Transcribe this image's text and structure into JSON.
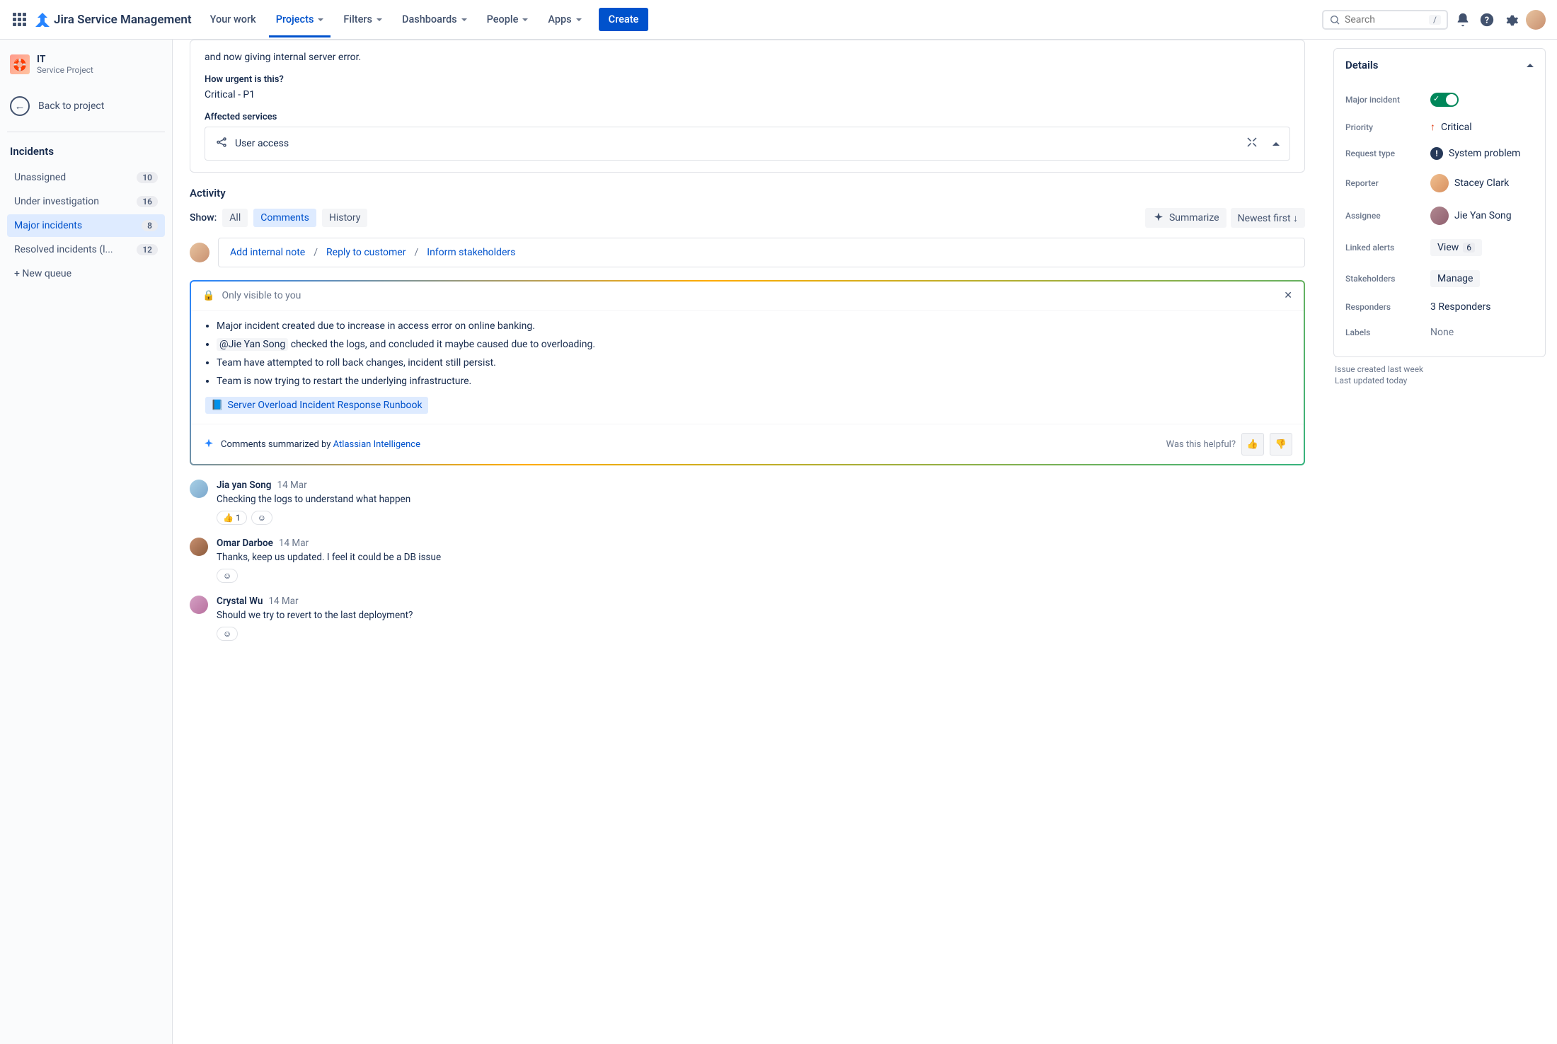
{
  "brand": "Jira Service Management",
  "nav": {
    "your_work": "Your work",
    "projects": "Projects",
    "filters": "Filters",
    "dashboards": "Dashboards",
    "people": "People",
    "apps": "Apps",
    "create": "Create",
    "search_placeholder": "Search",
    "search_kbd": "/"
  },
  "sidebar": {
    "project_name": "IT",
    "project_type": "Service Project",
    "back": "Back to project",
    "heading": "Incidents",
    "queues": [
      {
        "label": "Unassigned",
        "count": "10"
      },
      {
        "label": "Under investigation",
        "count": "16"
      },
      {
        "label": "Major incidents",
        "count": "8"
      },
      {
        "label": "Resolved incidents (l...",
        "count": "12"
      }
    ],
    "new_queue": "+ New queue"
  },
  "ticket": {
    "desc_tail": "and now giving internal server error.",
    "urgent_label": "How urgent is this?",
    "urgent_value": "Critical - P1",
    "affected_label": "Affected services",
    "service": "User access"
  },
  "activity": {
    "heading": "Activity",
    "show": "Show:",
    "all": "All",
    "comments": "Comments",
    "history": "History",
    "summarize": "Summarize",
    "newest": "Newest first ↓",
    "add_note": "Add internal note",
    "reply": "Reply to customer",
    "inform": "Inform stakeholders"
  },
  "ai": {
    "only_visible": "Only visible to you",
    "bullets": {
      "b1": "Major incident created due to increase in access error on online banking.",
      "b2_mention": "@Jie Yan Song",
      "b2_rest": "  checked the logs, and concluded it maybe caused due to overloading.",
      "b3": "Team have attempted to roll back changes, incident still persist.",
      "b4": "Team is now trying to restart the underlying infrastructure."
    },
    "runbook": "Server Overload Incident Response Runbook",
    "summ_by": "Comments summarized by ",
    "brand": "Atlassian Intelligence",
    "helpful": "Was this helpful?"
  },
  "comments": [
    {
      "author": "Jia yan Song",
      "date": "14 Mar",
      "text": "Checking the logs to understand what happen",
      "react": "👍",
      "react_count": "1"
    },
    {
      "author": "Omar Darboe",
      "date": "14 Mar",
      "text": "Thanks, keep us updated. I feel it could be a DB issue"
    },
    {
      "author": "Crystal Wu",
      "date": "14 Mar",
      "text": "Should we try to revert to the last deployment?"
    }
  ],
  "details": {
    "title": "Details",
    "major_label": "Major incident",
    "priority_label": "Priority",
    "priority_value": "Critical",
    "request_label": "Request type",
    "request_value": "System problem",
    "reporter_label": "Reporter",
    "reporter_value": "Stacey Clark",
    "assignee_label": "Assignee",
    "assignee_value": "Jie Yan Song",
    "alerts_label": "Linked alerts",
    "alerts_view": "View",
    "alerts_count": "6",
    "stakeholders_label": "Stakeholders",
    "stakeholders_manage": "Manage",
    "responders_label": "Responders",
    "responders_value": "3 Responders",
    "labels_label": "Labels",
    "labels_value": "None",
    "created": "Issue created last week",
    "updated": "Last updated today"
  }
}
